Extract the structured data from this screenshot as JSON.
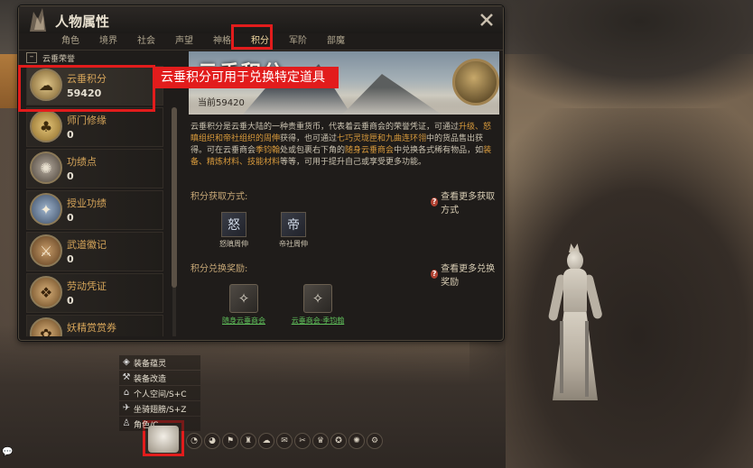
{
  "window": {
    "title": "人物属性",
    "tabs": [
      "角色",
      "境界",
      "社会",
      "声望",
      "神格",
      "积分",
      "军阶",
      "部魔"
    ],
    "active_tab": "积分"
  },
  "sidebar": {
    "group_label": "云垂荣誉",
    "group_toggle": "–",
    "items": [
      {
        "name": "云垂积分",
        "value": "59420",
        "icon": "cloud-medallion-icon"
      },
      {
        "name": "师门修缘",
        "value": "0",
        "icon": "clover-medallion-icon"
      },
      {
        "name": "功绩点",
        "value": "0",
        "icon": "dragon-medallion-icon"
      },
      {
        "name": "授业功绩",
        "value": "0",
        "icon": "crest-medallion-icon"
      },
      {
        "name": "武道徽记",
        "value": "0",
        "icon": "sword-medallion-icon"
      },
      {
        "name": "劳动凭证",
        "value": "0",
        "icon": "treasure-medallion-icon"
      },
      {
        "name": "妖精赏赏券",
        "value": "",
        "icon": "spirit-medallion-icon"
      }
    ]
  },
  "content": {
    "banner_title": "云垂积分",
    "current_label": "当前59420",
    "desc_parts": [
      {
        "t": "云垂积分是云垂大陆的一种贵重货币，代表着云垂商会的荣誉凭证，可通过",
        "h": false
      },
      {
        "t": "升级、怒瞋组织和帝社组织的周伸",
        "h": true
      },
      {
        "t": "获得，也可通过",
        "h": false
      },
      {
        "t": "七巧灵珑匣和九曲连环翎",
        "h": true
      },
      {
        "t": "中的货品售出获得。可在云垂商会",
        "h": false
      },
      {
        "t": "季钧翰",
        "h": true
      },
      {
        "t": "处或包裹右下角的",
        "h": false
      },
      {
        "t": "随身云垂商会",
        "h": true
      },
      {
        "t": "中兑换各式稀有物品，如",
        "h": false
      },
      {
        "t": "装备、精炼材料、技能材料",
        "h": true
      },
      {
        "t": "等等，可用于提升自己或享受更多功能。",
        "h": false
      }
    ],
    "acquire_label": "积分获取方式:",
    "acquire_more": "查看更多获取方式",
    "sources": [
      {
        "label": "怒瞋周伸",
        "glyph": "怒"
      },
      {
        "label": "帝社周伸",
        "glyph": "帝"
      }
    ],
    "exchange_label": "积分兑换奖励:",
    "exchange_more": "查看更多兑换奖励",
    "exchanges": [
      {
        "label": "随身云垂商会",
        "glyph": "✧"
      },
      {
        "label": "云垂商会·季钧翰",
        "glyph": "✧"
      }
    ]
  },
  "annotation": {
    "callout": "云垂积分可用于兑换特定道具"
  },
  "bottom_menu": [
    {
      "label": "装备蕴灵",
      "icon": "gem-icon"
    },
    {
      "label": "装备改造",
      "icon": "hammer-icon"
    },
    {
      "label": "个人空间/S+C",
      "icon": "home-icon"
    },
    {
      "label": "坐骑翅膀/S+Z",
      "icon": "wing-icon"
    },
    {
      "label": "角色/C",
      "icon": "character-icon"
    }
  ],
  "hotbar": [
    "◔",
    "◕",
    "⚑",
    "♜",
    "☁",
    "✉",
    "✂",
    "♛",
    "✪",
    "✺",
    "⚙"
  ],
  "colors": {
    "accent": "#e21c1c",
    "gold": "#d6a55a",
    "link_green": "#5fbf5a"
  }
}
